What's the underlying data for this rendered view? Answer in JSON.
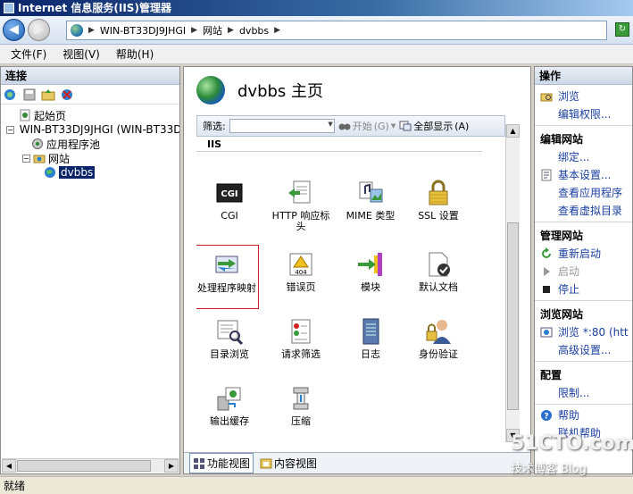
{
  "window": {
    "title": "Internet 信息服务(IIS)管理器"
  },
  "address": {
    "crumbs": [
      "WIN-BT33DJ9JHGI",
      "网站",
      "dvbbs"
    ]
  },
  "menu": {
    "items": [
      "文件(F)",
      "视图(V)",
      "帮助(H)"
    ]
  },
  "connections": {
    "header": "连接",
    "tree": {
      "start_page": "起始页",
      "server": "WIN-BT33DJ9JHGI (WIN-BT33D",
      "app_pools": "应用程序池",
      "sites": "网站",
      "site_selected": "dvbbs"
    }
  },
  "main": {
    "title": "dvbbs 主页",
    "filter": {
      "label": "筛选:",
      "start": "开始",
      "start_shortcut": "(G)",
      "show_all": "全部显示",
      "show_all_shortcut": "(A)"
    },
    "section": "IIS",
    "features": [
      {
        "label": "CGI",
        "icon": "cgi-icon",
        "icon_text": "CGI"
      },
      {
        "label": "HTTP 响应标头",
        "icon": "http-headers-icon"
      },
      {
        "label": "MIME 类型",
        "icon": "mime-types-icon"
      },
      {
        "label": "SSL 设置",
        "icon": "lock-icon"
      },
      {
        "label": "处理程序映射",
        "icon": "handler-mappings-icon",
        "selected": true
      },
      {
        "label": "错误页",
        "icon": "error-pages-icon",
        "icon_text": "404"
      },
      {
        "label": "模块",
        "icon": "modules-icon"
      },
      {
        "label": "默认文档",
        "icon": "default-document-icon"
      },
      {
        "label": "目录浏览",
        "icon": "directory-browsing-icon"
      },
      {
        "label": "请求筛选",
        "icon": "request-filtering-icon"
      },
      {
        "label": "日志",
        "icon": "logging-icon"
      },
      {
        "label": "身份验证",
        "icon": "authentication-icon"
      },
      {
        "label": "输出缓存",
        "icon": "output-caching-icon"
      },
      {
        "label": "压缩",
        "icon": "compression-icon"
      }
    ],
    "view_tabs": {
      "features": "功能视图",
      "content": "内容视图"
    }
  },
  "actions": {
    "header": "操作",
    "explore": "浏览",
    "edit_permissions": "编辑权限...",
    "edit_site_title": "编辑网站",
    "bindings": "绑定...",
    "basic_settings": "基本设置...",
    "view_apps": "查看应用程序",
    "view_vdirs": "查看虚拟目录",
    "manage_site_title": "管理网站",
    "restart": "重新启动",
    "start": "启动",
    "stop": "停止",
    "browse_site_title": "浏览网站",
    "browse_80": "浏览 *:80 (htt",
    "advanced_settings": "高级设置...",
    "configure_title": "配置",
    "limits": "限制...",
    "help": "帮助",
    "online_help": "联机帮助"
  },
  "status": {
    "text": "就绪"
  },
  "watermark": {
    "line1": "51CTO.com",
    "line2": "技术博客 Blog"
  }
}
